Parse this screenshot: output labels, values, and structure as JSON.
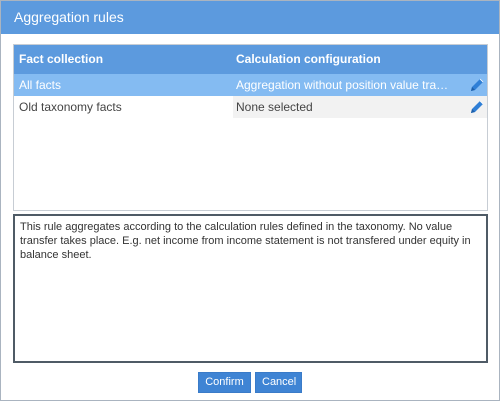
{
  "dialog": {
    "title": "Aggregation rules"
  },
  "grid": {
    "columns": {
      "fact_collection": "Fact collection",
      "calculation_configuration": "Calculation configuration"
    },
    "rows": [
      {
        "fact_collection": "All facts",
        "calculation_configuration": "Aggregation without position value transfer",
        "selected": true,
        "edit_icon": "pencil-icon"
      },
      {
        "fact_collection": "Old taxonomy facts",
        "calculation_configuration": "None selected",
        "selected": false,
        "edit_icon": "pencil-icon"
      }
    ]
  },
  "description": {
    "text": "This rule aggregates according to the calculation rules defined in the taxonomy. No value transfer takes place. E.g. net income from income statement is not transfered under equity in balance sheet."
  },
  "buttons": {
    "confirm_label": "Confirm",
    "cancel_label": "Cancel"
  },
  "colors": {
    "header_blue": "#5c9ade",
    "selected_row": "#84bbf2",
    "button_blue": "#3f84d4",
    "pencil_blue": "#2f7fd6"
  }
}
